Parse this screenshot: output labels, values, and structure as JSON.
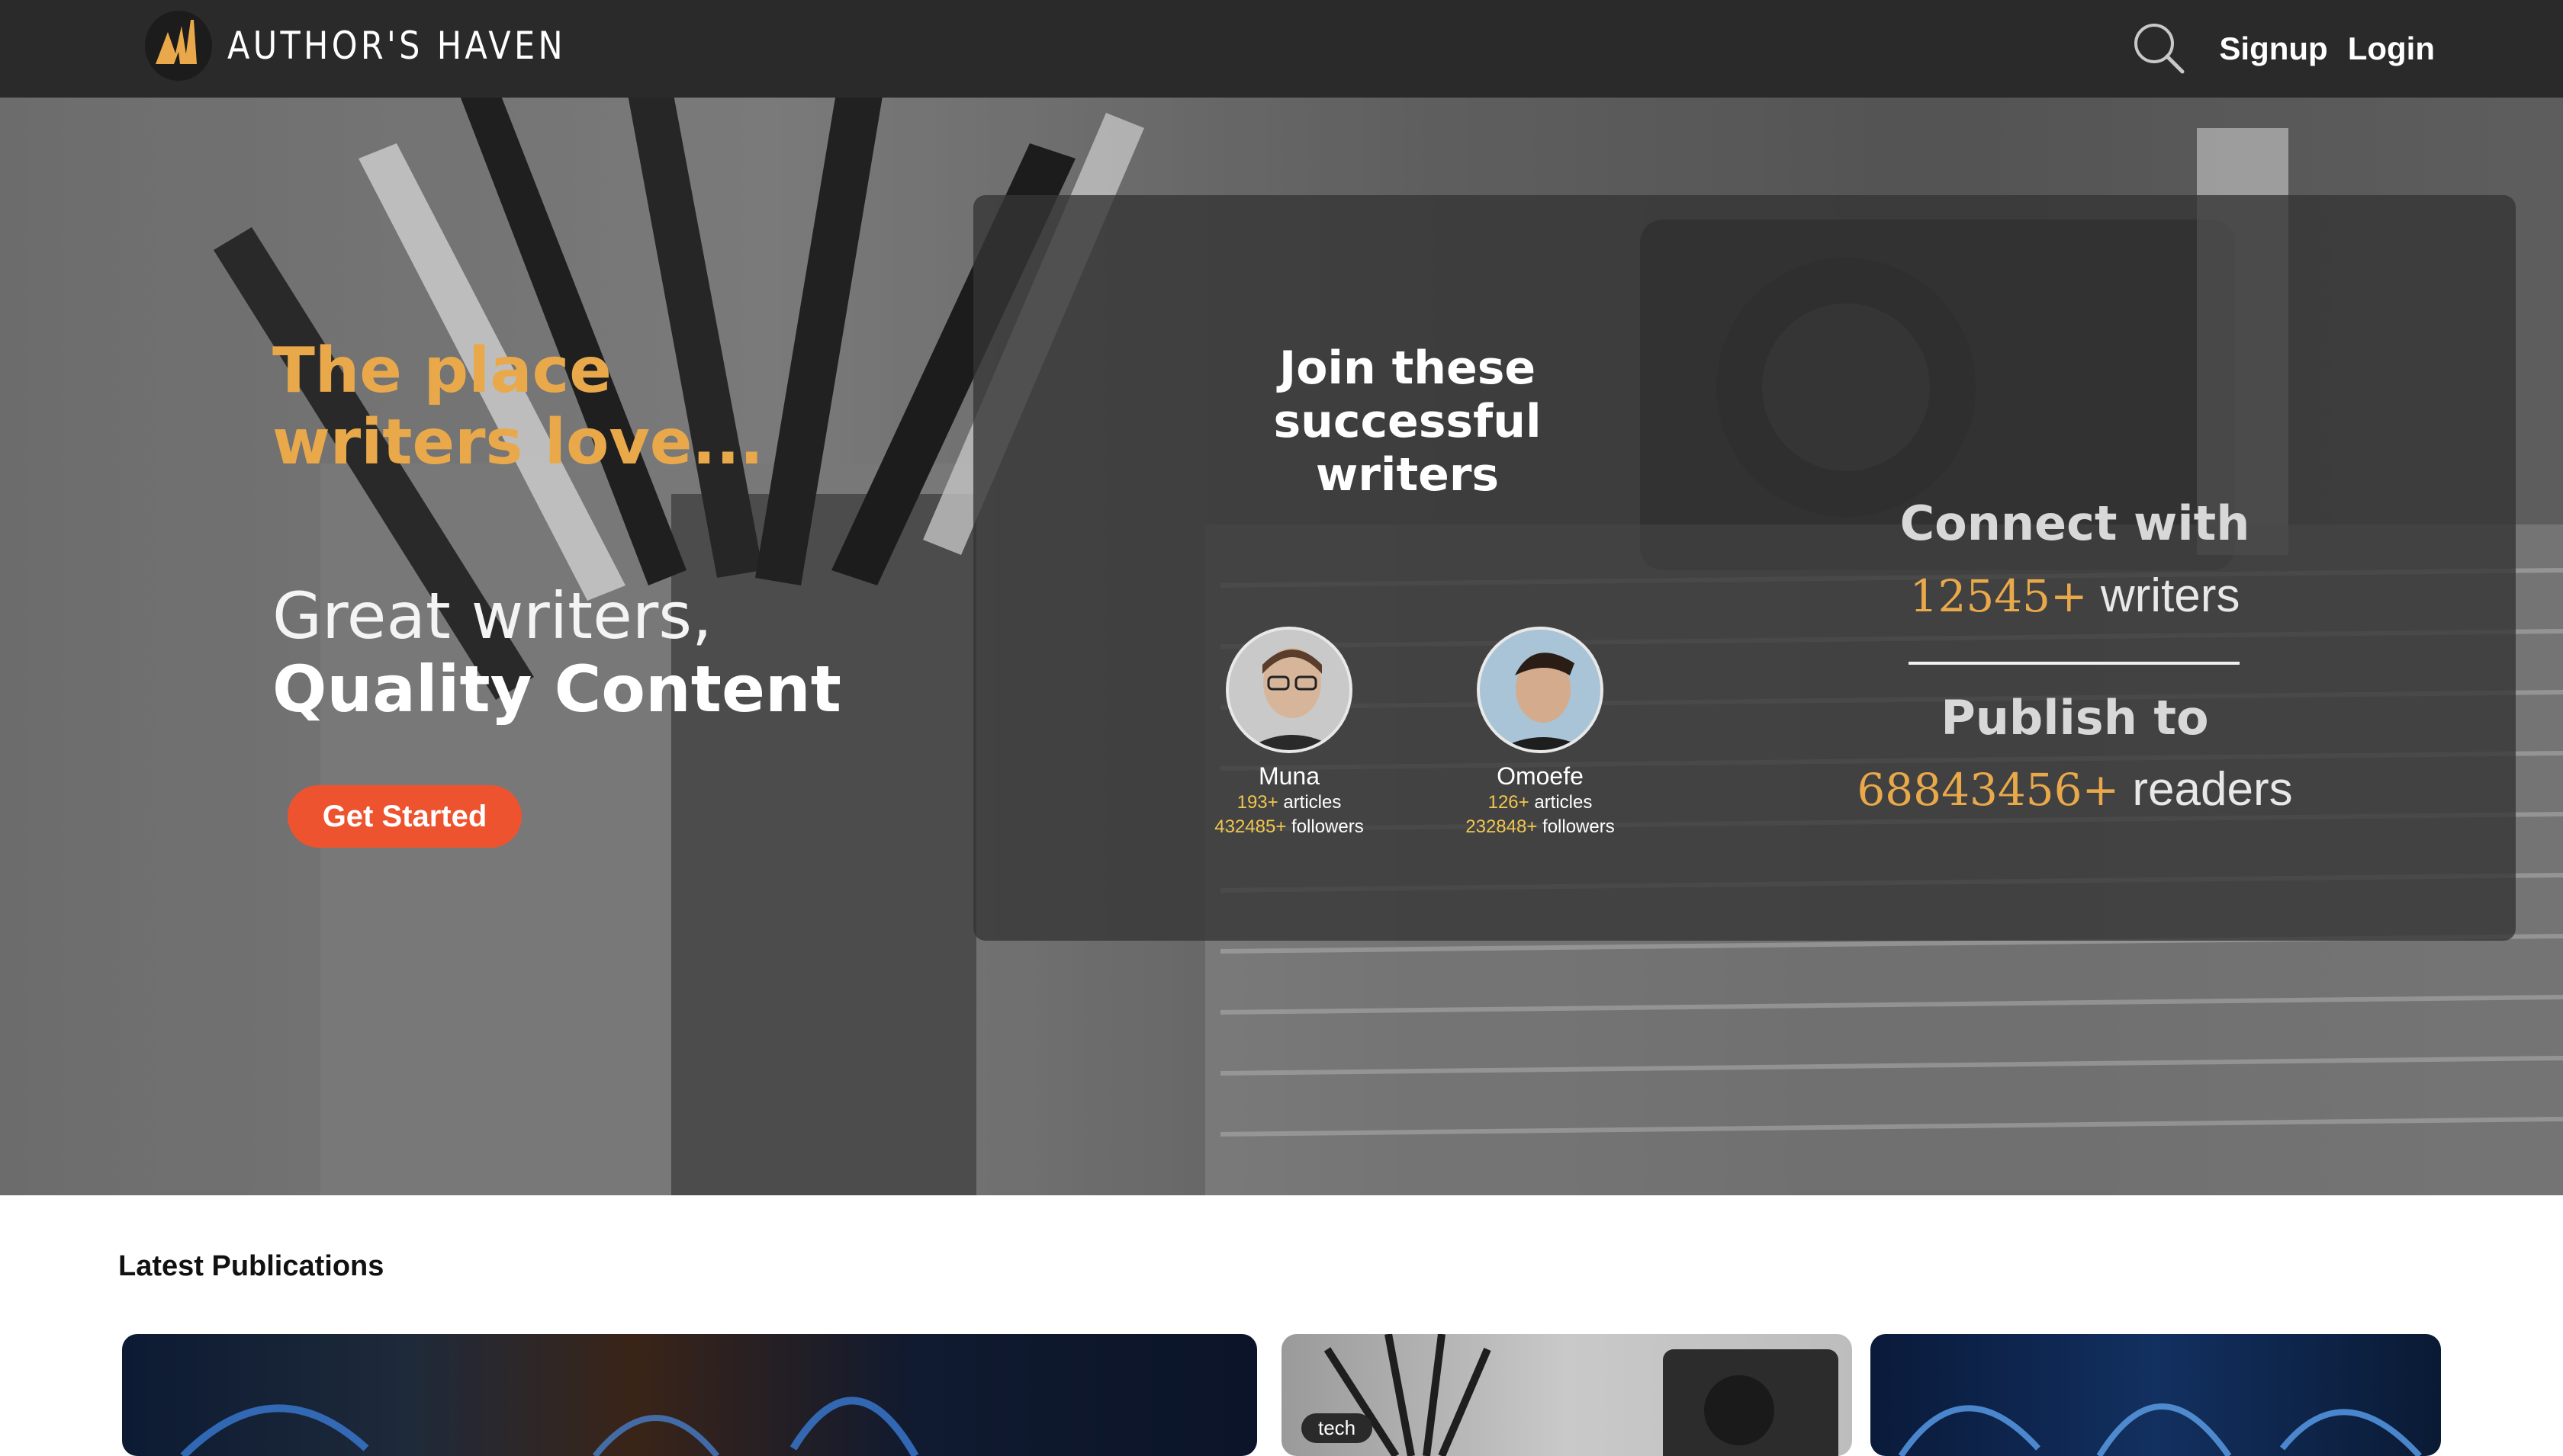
{
  "header": {
    "brand": "AUTHOR'S HAVEN",
    "signup_label": "Signup",
    "login_label": "Login",
    "icons": {
      "logo": "authors-haven-logo",
      "search": "search-icon"
    }
  },
  "hero": {
    "tagline_line1": "The place",
    "tagline_line2": "writers love...",
    "subtitle_line1": "Great writers,",
    "subtitle_line2": "Quality Content",
    "cta_label": "Get Started",
    "join_title": "Join these successful writers",
    "writers": [
      {
        "name": "Muna",
        "articles": "193+",
        "articles_label": "articles",
        "followers": "432485+",
        "followers_label": "followers"
      },
      {
        "name": "Omoefe",
        "articles": "126+",
        "articles_label": "articles",
        "followers": "232848+",
        "followers_label": "followers"
      }
    ],
    "connect_label": "Connect with",
    "writers_count": "12545+",
    "writers_label": "writers",
    "publish_label": "Publish to",
    "readers_count": "68843456+",
    "readers_label": "readers"
  },
  "latest": {
    "title": "Latest Publications",
    "cards": [
      {
        "tag": ""
      },
      {
        "tag": "tech"
      },
      {
        "tag": ""
      }
    ]
  },
  "colors": {
    "header_bg": "#2a2a2a",
    "accent_gold": "#e9a94a",
    "cta_orange": "#ee5330",
    "stat_yellow": "#f2c64d"
  }
}
